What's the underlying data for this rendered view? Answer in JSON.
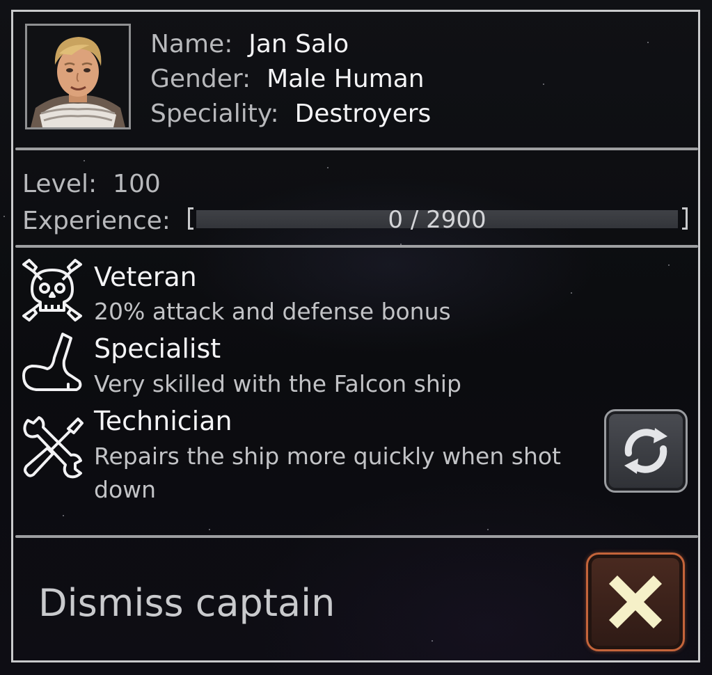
{
  "captain": {
    "name_label": "Name:",
    "name": "Jan Salo",
    "gender_label": "Gender:",
    "gender": "Male Human",
    "speciality_label": "Speciality:",
    "speciality": "Destroyers"
  },
  "stats": {
    "level_label": "Level:",
    "level": "100",
    "experience_label": "Experience:",
    "experience_text": "0 / 2900",
    "experience_current": 0,
    "experience_max": 2900
  },
  "traits": [
    {
      "title": "Veteran",
      "description": "20% attack and defense bonus",
      "icon": "skull-crossbones-icon"
    },
    {
      "title": "Specialist",
      "description": "Very skilled with the Falcon ship",
      "icon": "boot-icon"
    },
    {
      "title": "Technician",
      "description": "Repairs the ship more quickly when shot down",
      "icon": "wrench-screwdriver-icon"
    }
  ],
  "actions": {
    "reroll_icon": "refresh-icon",
    "dismiss_label": "Dismiss captain",
    "dismiss_icon": "close-icon"
  },
  "colors": {
    "frame": "#c9cacc",
    "dismiss_accent": "#c4643a",
    "close_x": "#f5f0c8"
  }
}
